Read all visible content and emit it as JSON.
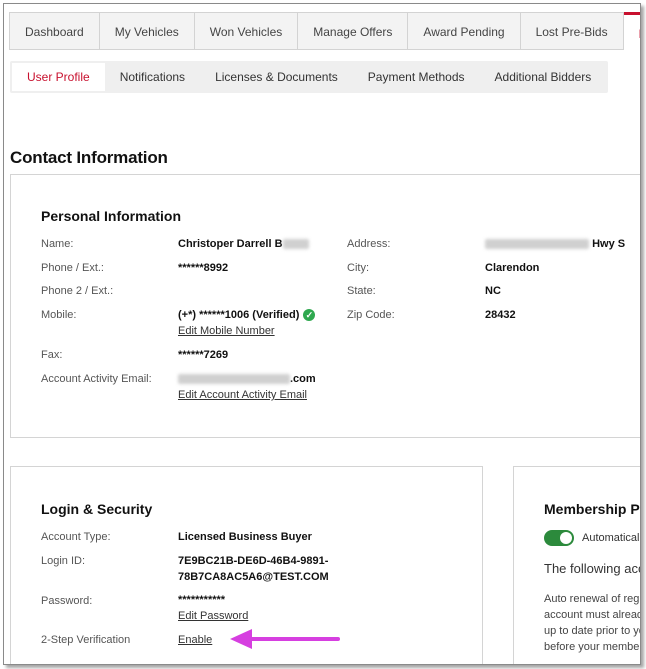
{
  "tabs": [
    {
      "label": "Dashboard"
    },
    {
      "label": "My Vehicles"
    },
    {
      "label": "Won Vehicles"
    },
    {
      "label": "Manage Offers"
    },
    {
      "label": "Award Pending"
    },
    {
      "label": "Lost Pre-Bids"
    },
    {
      "label": "Profile"
    }
  ],
  "subtabs": [
    {
      "label": "User Profile"
    },
    {
      "label": "Notifications"
    },
    {
      "label": "Licenses & Documents"
    },
    {
      "label": "Payment Methods"
    },
    {
      "label": "Additional Bidders"
    }
  ],
  "contact_title": "Contact Information",
  "personal": {
    "title": "Personal Information",
    "name_label": "Name:",
    "name_value": "Christoper Darrell B",
    "phone_label": "Phone / Ext.:",
    "phone_value": "******8992",
    "phone2_label": "Phone 2 / Ext.:",
    "mobile_label": "Mobile:",
    "mobile_value": "(+*) ******1006 (Verified)",
    "edit_mobile": "Edit Mobile Number",
    "fax_label": "Fax:",
    "fax_value": "******7269",
    "email_label": "Account Activity Email:",
    "email_value_suffix": ".com",
    "edit_email": "Edit Account Activity Email",
    "address_label": "Address:",
    "address_value_suffix": "Hwy S",
    "city_label": "City:",
    "city_value": "Clarendon",
    "state_label": "State:",
    "state_value": "NC",
    "zip_label": "Zip Code:",
    "zip_value": "28432"
  },
  "login": {
    "title": "Login & Security",
    "account_type_label": "Account Type:",
    "account_type_value": "Licensed Business Buyer",
    "login_id_label": "Login ID:",
    "login_id_line1": "7E9BC21B-DE6D-46B4-9891-",
    "login_id_line2": "78B7CA8AC5A6@TEST.COM",
    "password_label": "Password:",
    "password_value": "***********",
    "edit_password": "Edit Password",
    "twostep_label": "2-Step Verification",
    "enable_link": "Enable"
  },
  "membership": {
    "title": "Membership Pa",
    "auto_label": "Automatical",
    "following": "The following acc",
    "desc_lines": [
      "Auto renewal of regi",
      "account must alread",
      "up to date prior to yo",
      "before your member"
    ]
  },
  "colors": {
    "accent": "#c8102e",
    "arrow": "#d63fe0",
    "toggle": "#2c8a3c"
  }
}
